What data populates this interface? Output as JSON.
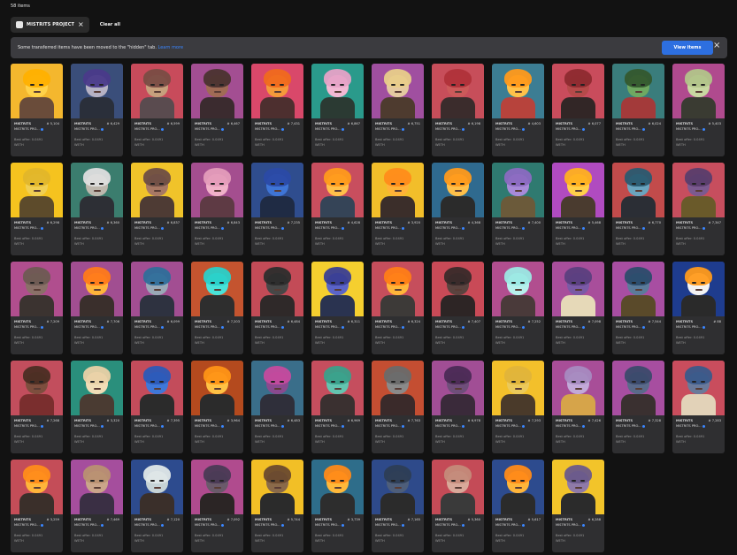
{
  "items_count": "58 items",
  "filters": {
    "collection_chip": "MISTRITS PROJECT",
    "clear_all": "Clear all"
  },
  "banner": {
    "message": "Some transferred items have been moved to the \"hidden\" tab.",
    "link": "Learn more",
    "button": "View items"
  },
  "card_common": {
    "title_short": "MISTRITS PRO...",
    "best_offer": "Best offer: 0.0491",
    "currency": "WETH"
  },
  "cards": [
    {
      "title": "MISTRITS",
      "number": "# 5,104",
      "bg": "#f4b72e",
      "hair": "#ffb000",
      "face": "#ffd24a",
      "body": "#6a4c3a"
    },
    {
      "title": "MISTRITS",
      "number": "# 6,429",
      "bg": "#3a4e7a",
      "hair": "#4a3a8a",
      "face": "#b6b2c4",
      "body": "#2a2f3a"
    },
    {
      "title": "MISTRITS",
      "number": "# 6,599",
      "bg": "#c84b5b",
      "hair": "#7a4c45",
      "face": "#c7a07d",
      "body": "#5a4b4f"
    },
    {
      "title": "MISTRITS",
      "number": "# 6,467",
      "bg": "#a34e92",
      "hair": "#4b3330",
      "face": "#a06b55",
      "body": "#3b2b2f"
    },
    {
      "title": "MISTRITS",
      "number": "# 7,431",
      "bg": "#d9486a",
      "hair": "#f06a1e",
      "face": "#f59a3a",
      "body": "#4d2f2f"
    },
    {
      "title": "MISTRITS",
      "number": "# 6,867",
      "bg": "#2a9a8b",
      "hair": "#e6a2c7",
      "face": "#f2b8d3",
      "body": "#2b3a33"
    },
    {
      "title": "MISTRITS",
      "number": "# 6,751",
      "bg": "#a04fa0",
      "hair": "#e8cd8a",
      "face": "#e4c9a1",
      "body": "#4e3b2f"
    },
    {
      "title": "MISTRITS",
      "number": "# 6,198",
      "bg": "#c74e5a",
      "hair": "#b0323a",
      "face": "#cc5a5a",
      "body": "#3b2c2c"
    },
    {
      "title": "MISTRITS",
      "number": "# 4,603",
      "bg": "#3c7d93",
      "hair": "#ff9a1b",
      "face": "#ffc24a",
      "body": "#b7433c"
    },
    {
      "title": "MISTRITS",
      "number": "# 6,077",
      "bg": "#c94c5c",
      "hair": "#8e2a2f",
      "face": "#b64a4a",
      "body": "#322626"
    },
    {
      "title": "MISTRITS",
      "number": "# 6,024",
      "bg": "#3a7d7c",
      "hair": "#34592e",
      "face": "#6fa861",
      "body": "#a33a3a"
    },
    {
      "title": "MISTRITS",
      "number": "# 5,403",
      "bg": "#b04a8e",
      "hair": "#b2c48a",
      "face": "#c8d7a1",
      "body": "#3a3b32"
    },
    {
      "title": "MISTRITS",
      "number": "# 6,298",
      "bg": "#f5c31f",
      "hair": "#e1b62a",
      "face": "#f1cf53",
      "body": "#5d4b2b"
    },
    {
      "title": "MISTRITS",
      "number": "# 6,360",
      "bg": "#3b7d6e",
      "hair": "#dedede",
      "face": "#bdb7ad",
      "body": "#2d2f35"
    },
    {
      "title": "MISTRITS",
      "number": "# 6,837",
      "bg": "#f0c32a",
      "hair": "#6e4e44",
      "face": "#a77864",
      "body": "#4e3b34"
    },
    {
      "title": "MISTRITS",
      "number": "# 6,843",
      "bg": "#a44e8f",
      "hair": "#e49cbb",
      "face": "#f0b1c8",
      "body": "#5e3a44"
    },
    {
      "title": "MISTRITS",
      "number": "# 7,235",
      "bg": "#2f4d8e",
      "hair": "#2b4aa7",
      "face": "#3f75d6",
      "body": "#1f2b44"
    },
    {
      "title": "MISTRITS",
      "number": "# 4,628",
      "bg": "#c84e5e",
      "hair": "#ff9a1b",
      "face": "#ffc04a",
      "body": "#354457"
    },
    {
      "title": "MISTRITS",
      "number": "# 3,920",
      "bg": "#f2be2a",
      "hair": "#ff8c1a",
      "face": "#ffb238",
      "body": "#3b2e2a"
    },
    {
      "title": "MISTRITS",
      "number": "# 4,368",
      "bg": "#2f6a8f",
      "hair": "#ff9a1b",
      "face": "#ffc04a",
      "body": "#2b2b2b"
    },
    {
      "title": "MISTRITS",
      "number": "# 7,400",
      "bg": "#2f7a70",
      "hair": "#8b6ac1",
      "face": "#a88ad8",
      "body": "#6b5a3a"
    },
    {
      "title": "MISTRITS",
      "number": "# 5,468",
      "bg": "#b04bc0",
      "hair": "#ffb020",
      "face": "#ffd04a",
      "body": "#4a3b2f"
    },
    {
      "title": "MISTRITS",
      "number": "# 6,770",
      "bg": "#c24b4b",
      "hair": "#2a5a70",
      "face": "#6aa5bf",
      "body": "#2b2e35"
    },
    {
      "title": "MISTRITS",
      "number": "# 7,347",
      "bg": "#c74e5e",
      "hair": "#5a3d6c",
      "face": "#7b5a8f",
      "body": "#6a5a2a"
    },
    {
      "title": "MISTRITS",
      "number": "# 7,209",
      "bg": "#b04e8e",
      "hair": "#6e5a53",
      "face": "#8a7068",
      "body": "#3b3330"
    },
    {
      "title": "MISTRITS",
      "number": "# 7,706",
      "bg": "#a14e91",
      "hair": "#ff7a1a",
      "face": "#ffb53a",
      "body": "#3a2f2c"
    },
    {
      "title": "MISTRITS",
      "number": "# 6,099",
      "bg": "#a24e92",
      "hair": "#2f6e9a",
      "face": "#9aa9b7",
      "body": "#2e3240"
    },
    {
      "title": "MISTRITS",
      "number": "# 7,203",
      "bg": "#c4542f",
      "hair": "#2ad0c9",
      "face": "#49e3d9",
      "body": "#2e2e2e"
    },
    {
      "title": "MISTRITS",
      "number": "# 6,484",
      "bg": "#c34b57",
      "hair": "#2d2d2d",
      "face": "#474747",
      "body": "#2f2929"
    },
    {
      "title": "MISTRITS",
      "number": "# 6,311",
      "bg": "#f5cf2f",
      "hair": "#3a3e94",
      "face": "#5b64c8",
      "body": "#2a3350"
    },
    {
      "title": "MISTRITS",
      "number": "# 6,324",
      "bg": "#c64e5c",
      "hair": "#ff7d16",
      "face": "#ffb63a",
      "body": "#3d3a38"
    },
    {
      "title": "MISTRITS",
      "number": "# 7,407",
      "bg": "#c94a57",
      "hair": "#3a2a2a",
      "face": "#5a433f",
      "body": "#2d2525"
    },
    {
      "title": "MISTRITS",
      "number": "# 7,252",
      "bg": "#b14e8f",
      "hair": "#9be8e4",
      "face": "#b7f0ec",
      "body": "#4a3a3a"
    },
    {
      "title": "MISTRITS",
      "number": "# 7,098",
      "bg": "#a84e9b",
      "hair": "#5b3f7e",
      "face": "#7a5aa6",
      "body": "#e6d9b8"
    },
    {
      "title": "MISTRITS",
      "number": "# 7,544",
      "bg": "#a84ea2",
      "hair": "#2b4c6b",
      "face": "#5b7b9a",
      "body": "#5a4a2a"
    },
    {
      "title": "MISTRITS",
      "number": "# 88",
      "bg": "#1e3c8e",
      "hair": "#ff9a1b",
      "face": "#f3f3f3",
      "body": "#2a2a2a"
    },
    {
      "title": "MISTRITS",
      "number": "# 7,268",
      "bg": "#c24e5d",
      "hair": "#4b2d23",
      "face": "#7d4e3e",
      "body": "#7a2e2e"
    },
    {
      "title": "MISTRITS",
      "number": "# 3,320",
      "bg": "#2a8f7c",
      "hair": "#e9d1a6",
      "face": "#f0ddb7",
      "body": "#4a3b32"
    },
    {
      "title": "MISTRITS",
      "number": "# 7,395",
      "bg": "#c34c5b",
      "hair": "#2c5ab8",
      "face": "#3f78d9",
      "body": "#2b2b2b"
    },
    {
      "title": "MISTRITS",
      "number": "# 3,964",
      "bg": "#b44a1e",
      "hair": "#ff9316",
      "face": "#ffc245",
      "body": "#2b2b2b"
    },
    {
      "title": "MISTRITS",
      "number": "# 6,483",
      "bg": "#3a6e8a",
      "hair": "#c54a9e",
      "face": "#8a4a8f",
      "body": "#2f2f3a"
    },
    {
      "title": "MISTRITS",
      "number": "# 6,969",
      "bg": "#c54e5e",
      "hair": "#39a08a",
      "face": "#63c4b0",
      "body": "#3a3030"
    },
    {
      "title": "MISTRITS",
      "number": "# 7,763",
      "bg": "#c44e32",
      "hair": "#6a6a6a",
      "face": "#8a8a8a",
      "body": "#3a2a2a"
    },
    {
      "title": "MISTRITS",
      "number": "# 6,978",
      "bg": "#a14e95",
      "hair": "#4b2a55",
      "face": "#6f4e7a",
      "body": "#3a2a3a"
    },
    {
      "title": "MISTRITS",
      "number": "# 7,293",
      "bg": "#f3c02b",
      "hair": "#e0b43a",
      "face": "#ebc95b",
      "body": "#4a3a2a"
    },
    {
      "title": "MISTRITS",
      "number": "# 7,426",
      "bg": "#a84e98",
      "hair": "#a78ac0",
      "face": "#c2a9d8",
      "body": "#d6a44a"
    },
    {
      "title": "MISTRITS",
      "number": "# 7,328",
      "bg": "#a74ea0",
      "hair": "#3b4a6b",
      "face": "#5a6a8a",
      "body": "#3a3030"
    },
    {
      "title": "MISTRITS",
      "number": "# 7,283",
      "bg": "#c94d5d",
      "hair": "#3a5a8a",
      "face": "#6a7a9a",
      "body": "#e2d2b8"
    },
    {
      "title": "MISTRITS",
      "number": "# 3,259",
      "bg": "#c44d58",
      "hair": "#ff8c1a",
      "face": "#ffb53a",
      "body": "#3a2f2a"
    },
    {
      "title": "MISTRITS",
      "number": "# 7,469",
      "bg": "#a54e9d",
      "hair": "#b89072",
      "face": "#caa58a",
      "body": "#3a2f44"
    },
    {
      "title": "MISTRITS",
      "number": "# 7,120",
      "bg": "#2d4b8e",
      "hair": "#dfe7e8",
      "face": "#c6d3d6",
      "body": "#3a2f2a"
    },
    {
      "title": "MISTRITS",
      "number": "# 7,092",
      "bg": "#b04b8e",
      "hair": "#4a3a55",
      "face": "#6a5a6a",
      "body": "#2b2525"
    },
    {
      "title": "MISTRITS",
      "number": "# 5,744",
      "bg": "#f2bf26",
      "hair": "#6a4a2e",
      "face": "#8a6a4a",
      "body": "#2b2b2b"
    },
    {
      "title": "MISTRITS",
      "number": "# 3,739",
      "bg": "#2e6d8a",
      "hair": "#ff8a18",
      "face": "#ffb83a",
      "body": "#2d2d2d"
    },
    {
      "title": "MISTRITS",
      "number": "# 7,165",
      "bg": "#2e4a8a",
      "hair": "#2d3d55",
      "face": "#4e5e7a",
      "body": "#2b2b2b"
    },
    {
      "title": "MISTRITS",
      "number": "# 5,360",
      "bg": "#c44b57",
      "hair": "#c48a7a",
      "face": "#d8a99a",
      "body": "#3a3a3a"
    },
    {
      "title": "MISTRITS",
      "number": "# 5,617",
      "bg": "#2d4b8e",
      "hair": "#ff8a18",
      "face": "#ffb53a",
      "body": "#2b2b2b"
    },
    {
      "title": "MISTRITS",
      "number": "# 6,288",
      "bg": "#f2c42a",
      "hair": "#6a5a8a",
      "face": "#8f7aa8",
      "body": "#2b2b2b"
    }
  ],
  "colors": {
    "page_bg": "#121212",
    "card_bg": "#2f2f31",
    "banner_bg": "#3b3b3f",
    "accent_blue": "#2d6fe0"
  },
  "icons": {
    "collection_chip_icon": "collection-avatar-icon",
    "chip_remove_icon": "close-icon",
    "banner_close_icon": "close-icon",
    "verified_badge_icon": "verified-badge-icon"
  }
}
